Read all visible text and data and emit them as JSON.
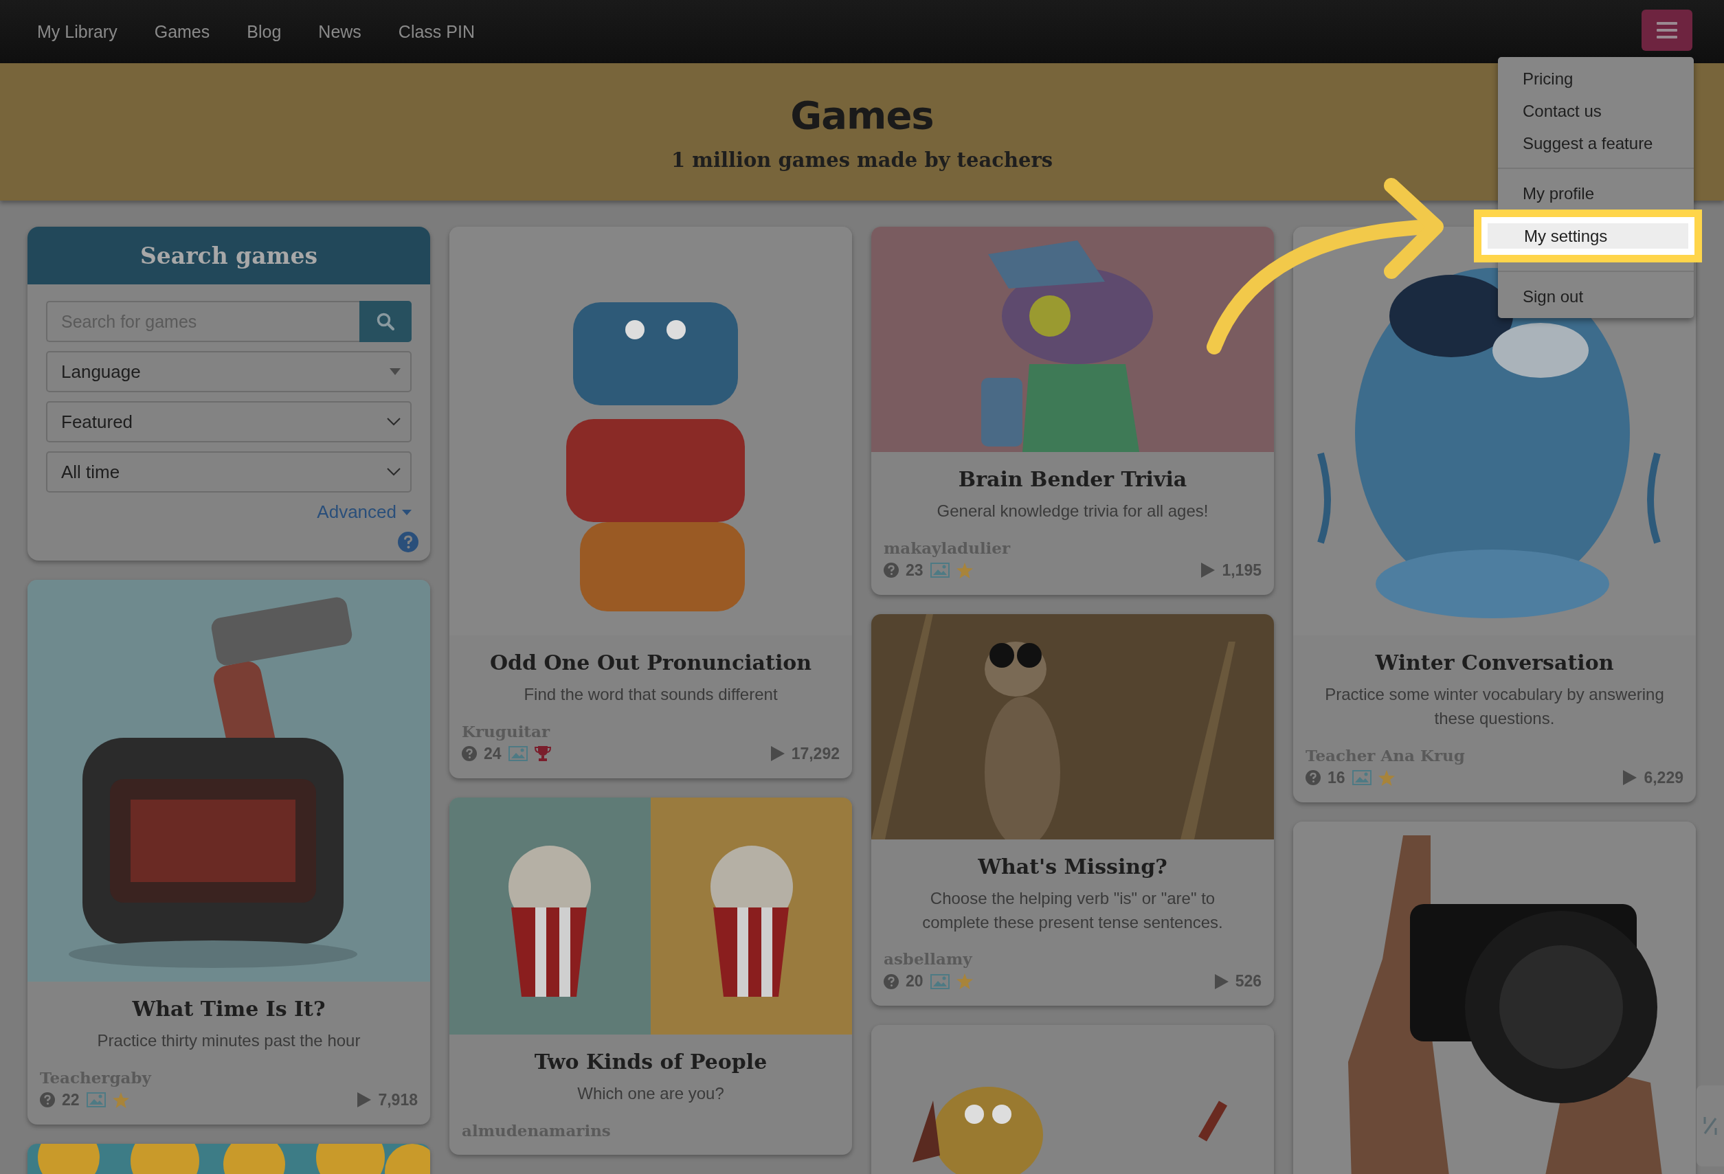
{
  "nav": {
    "items": [
      {
        "label": "My Library"
      },
      {
        "label": "Games"
      },
      {
        "label": "Blog"
      },
      {
        "label": "News"
      },
      {
        "label": "Class PIN"
      }
    ]
  },
  "menu": {
    "groups": [
      [
        {
          "label": "Pricing",
          "selected": false
        },
        {
          "label": "Contact us",
          "selected": false
        },
        {
          "label": "Suggest a feature",
          "selected": false
        }
      ],
      [
        {
          "label": "My profile",
          "selected": false
        },
        {
          "label": "My settings",
          "selected": true
        }
      ],
      [
        {
          "label": "Sign out",
          "selected": false
        }
      ]
    ]
  },
  "banner": {
    "title": "Games",
    "subtitle": "1 million games made by teachers"
  },
  "sidebar": {
    "title": "Search games",
    "search": {
      "placeholder": "Search for games"
    },
    "selects": [
      {
        "value": "Language",
        "kind": "caret"
      },
      {
        "value": "Featured",
        "kind": "chevron"
      },
      {
        "value": "All time",
        "kind": "chevron"
      }
    ],
    "advanced": "Advanced"
  },
  "columns": [
    [
      {
        "title": "What Time Is It?",
        "description": "Practice thirty minutes past the hour",
        "author": "Teachergaby",
        "questions": "22",
        "badge": {
          "kind": "star"
        },
        "plays": "7,918"
      }
    ],
    [
      {
        "title": "Odd One Out Pronunciation",
        "description": "Find the word that sounds different",
        "author": "Kruguitar",
        "questions": "24",
        "badge": {
          "kind": "trophy"
        },
        "plays": "17,292"
      },
      {
        "title": "Two Kinds of People",
        "description": "Which one are you?",
        "author": "almudenamarins"
      }
    ],
    [
      {
        "title": "Brain Bender Trivia",
        "description": "General knowledge trivia for all ages!",
        "author": "makayladulier",
        "questions": "23",
        "badge": {
          "kind": "star"
        },
        "plays": "1,195"
      },
      {
        "title": "What's Missing?",
        "description": "Choose the helping verb \"is\" or \"are\" to complete these present tense sentences.",
        "author": "asbellamy",
        "questions": "20",
        "badge": {
          "kind": "star"
        },
        "plays": "526"
      }
    ],
    [
      {
        "title": "Winter Conversation",
        "description": "Practice some winter vocabulary by answering these questions.",
        "author": "Teacher Ana Krug",
        "questions": "16",
        "badge": {
          "kind": "star"
        },
        "plays": "6,229"
      }
    ]
  ]
}
